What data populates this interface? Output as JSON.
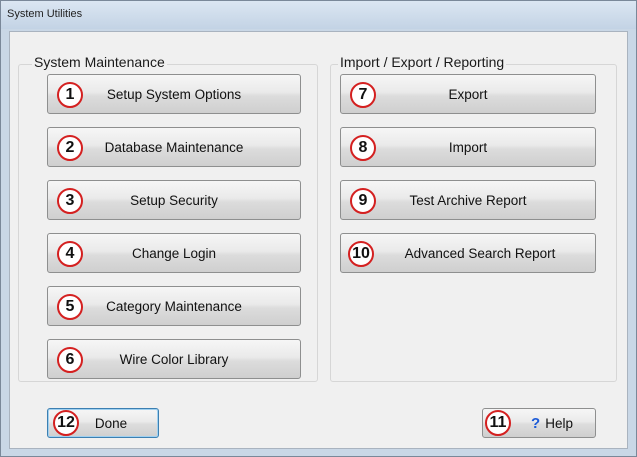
{
  "window": {
    "title": "System Utilities"
  },
  "maintenance": {
    "label": "System Maintenance",
    "buttons": [
      {
        "number": "1",
        "label": "Setup System Options"
      },
      {
        "number": "2",
        "label": "Database Maintenance"
      },
      {
        "number": "3",
        "label": "Setup Security"
      },
      {
        "number": "4",
        "label": "Change Login"
      },
      {
        "number": "5",
        "label": "Category Maintenance"
      },
      {
        "number": "6",
        "label": "Wire Color Library"
      }
    ]
  },
  "reporting": {
    "label": "Import / Export / Reporting",
    "buttons": [
      {
        "number": "7",
        "label": "Export"
      },
      {
        "number": "8",
        "label": "Import"
      },
      {
        "number": "9",
        "label": "Test Archive Report"
      },
      {
        "number": "10",
        "label": "Advanced Search Report"
      }
    ]
  },
  "footer": {
    "done": {
      "number": "12",
      "label": "Done"
    },
    "help": {
      "number": "11",
      "label": "Help",
      "icon": "?"
    }
  },
  "colors": {
    "badge_ring": "#d42020",
    "help_icon": "#1c5bd8",
    "focus_border": "#3c7fb1"
  }
}
